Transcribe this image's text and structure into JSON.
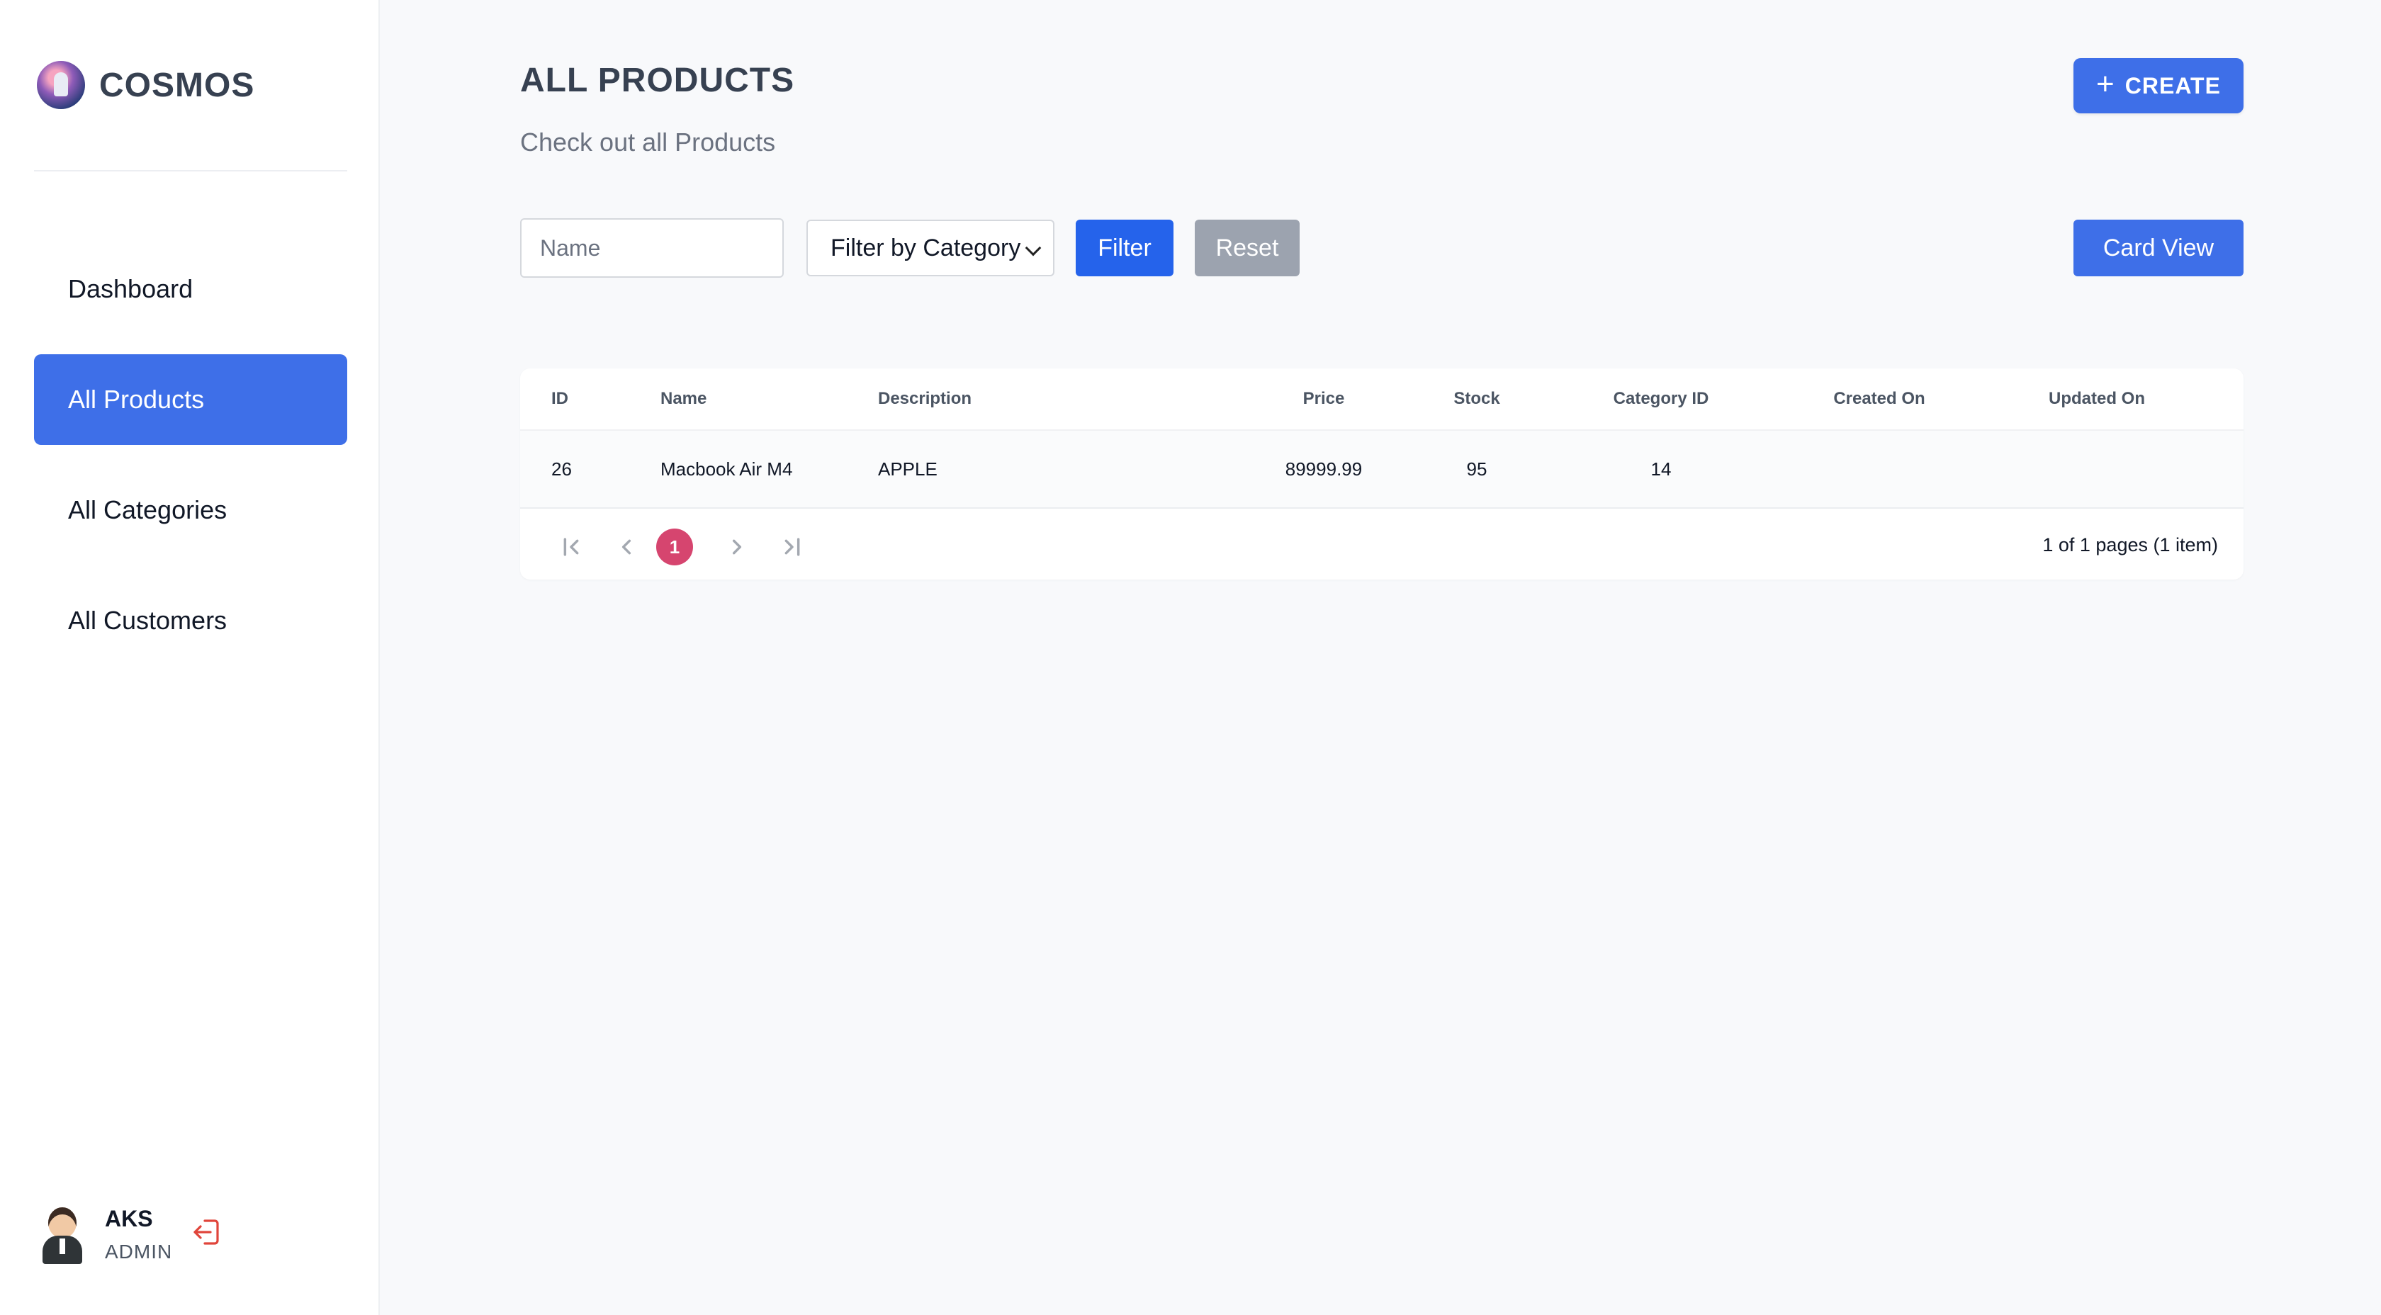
{
  "sidebar": {
    "brand": "COSMOS",
    "items": [
      {
        "label": "Dashboard"
      },
      {
        "label": "All Products"
      },
      {
        "label": "All Categories"
      },
      {
        "label": "All Customers"
      }
    ],
    "user": {
      "name": "AKS",
      "role": "ADMIN"
    }
  },
  "header": {
    "title": "ALL PRODUCTS",
    "subtitle": "Check out all Products",
    "create_label": "CREATE"
  },
  "filters": {
    "name_placeholder": "Name",
    "name_value": "",
    "category_selected": "Filter by Category",
    "filter_label": "Filter",
    "reset_label": "Reset",
    "card_view_label": "Card View"
  },
  "table": {
    "columns": [
      "ID",
      "Name",
      "Description",
      "Price",
      "Stock",
      "Category ID",
      "Created On",
      "Updated On"
    ],
    "rows": [
      [
        "26",
        "Macbook Air M4",
        "APPLE",
        "89999.99",
        "95",
        "14",
        "",
        ""
      ]
    ]
  },
  "pagination": {
    "current_page": "1",
    "info": "1 of 1 pages (1 item)"
  },
  "colors": {
    "accent": "#3e6fe8",
    "filter": "#2563eb",
    "reset": "#9ca3af",
    "page_active": "#d6456f",
    "logout": "#e0453b"
  }
}
